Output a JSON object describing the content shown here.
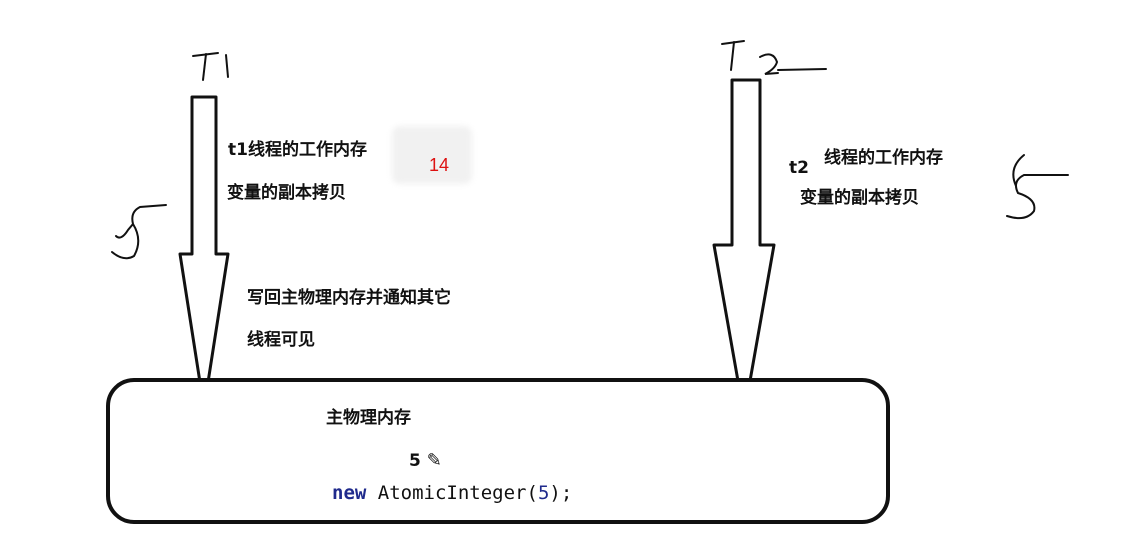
{
  "threads": {
    "t1": {
      "handwritten_title": "T1",
      "memory_line1": "t1线程的工作内存",
      "memory_line2": "变量的副本拷贝",
      "write_back_line1": "写回主物理内存并通知其它",
      "write_back_line2": "线程可见",
      "handwritten_value": "5",
      "sticky_value": "14"
    },
    "t2": {
      "handwritten_title": "T2",
      "name": "t2",
      "memory_line1": "线程的工作内存",
      "memory_line2": "变量的副本拷贝",
      "handwritten_value": "5"
    }
  },
  "main_memory": {
    "title": "主物理内存",
    "value": "5",
    "code_keyword": "new",
    "code_class": "AtomicInteger(",
    "code_arg": "5",
    "code_end": ");"
  },
  "colors": {
    "ink": "#111111",
    "keyword": "#1f2a8c",
    "sticky_value": "#dd1111"
  },
  "icons": {
    "edit": "pencil-icon"
  }
}
